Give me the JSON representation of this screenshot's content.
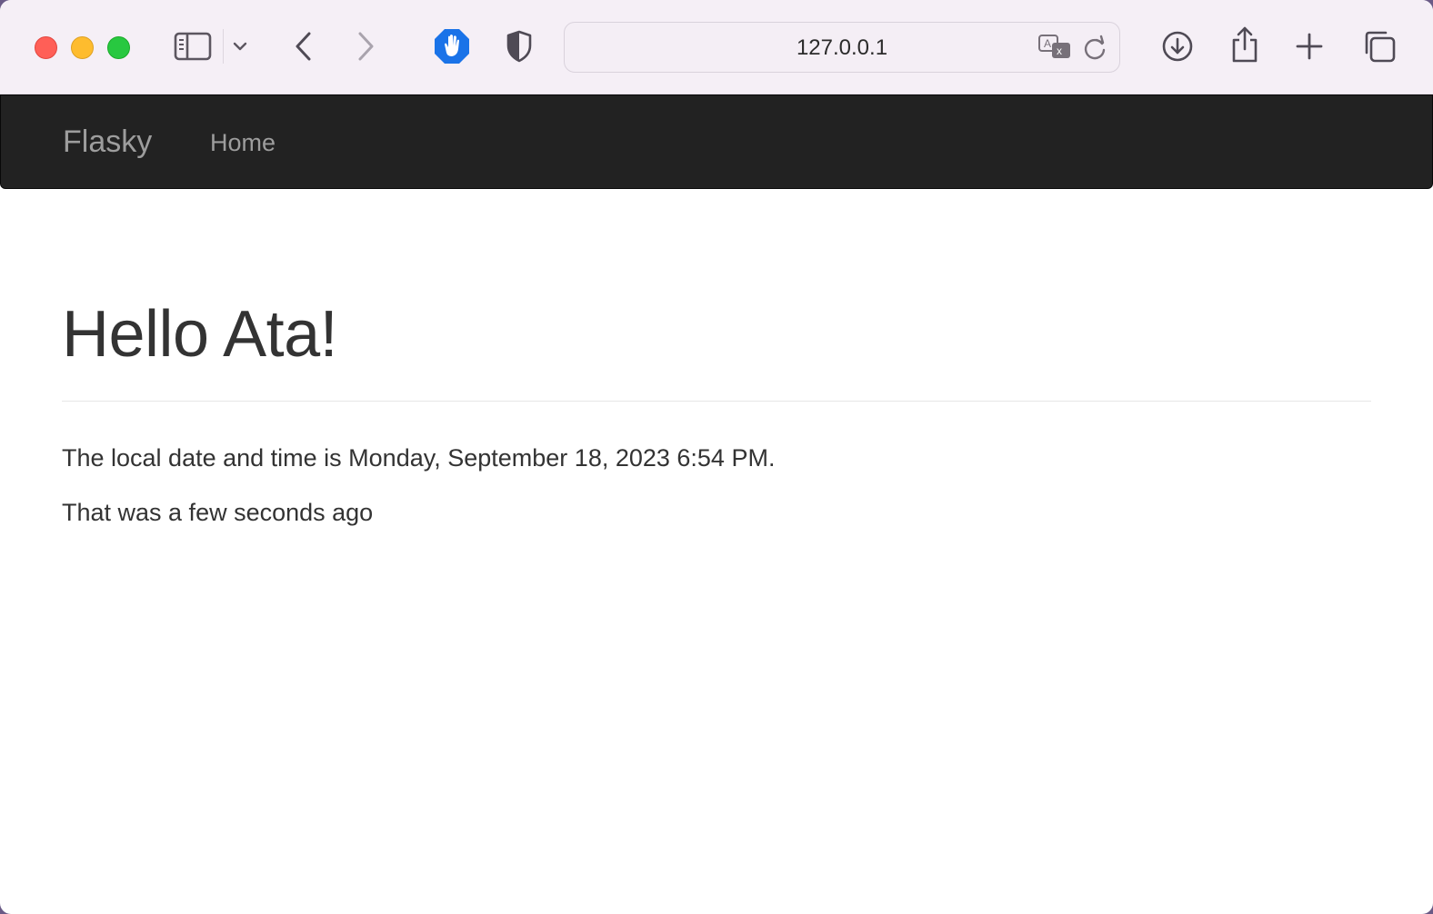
{
  "browser": {
    "url": "127.0.0.1",
    "icons": [
      "sidebar-icon",
      "chevron-down-icon",
      "back-icon",
      "forward-icon",
      "adblock-hand-icon",
      "privacy-shield-icon",
      "translate-icon",
      "reload-icon",
      "download-icon",
      "share-icon",
      "new-tab-icon",
      "tab-overview-icon"
    ]
  },
  "navbar": {
    "brand": "Flasky",
    "links": [
      {
        "label": "Home"
      }
    ]
  },
  "main": {
    "heading": "Hello Ata!",
    "local_time_text": "The local date and time is Monday, September 18, 2023 6:54 PM.",
    "relative_time_text": "That was a few seconds ago"
  },
  "colors": {
    "navbar_bg": "#222222",
    "navbar_text": "#9d9d9d",
    "text": "#333333",
    "adblock_blue": "#1a73e8"
  }
}
